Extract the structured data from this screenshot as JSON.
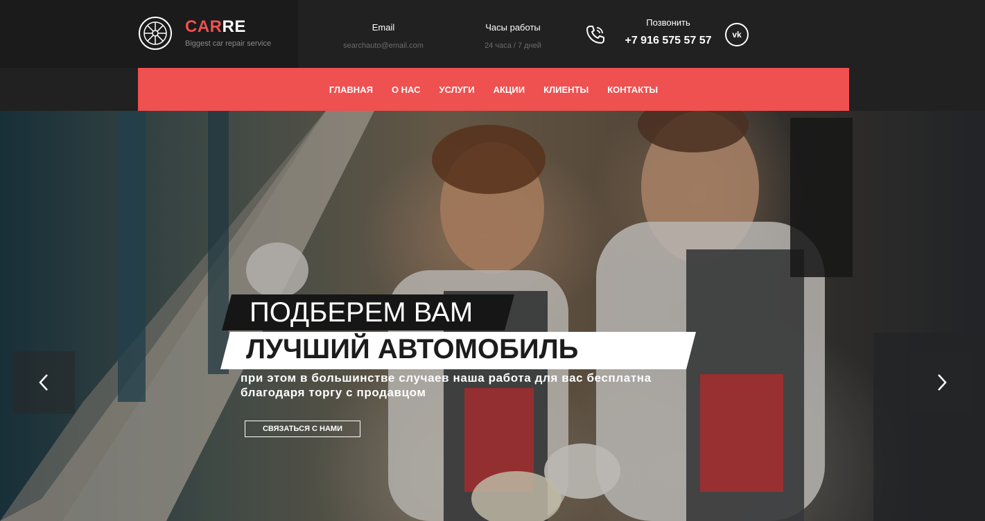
{
  "brand": {
    "name_part1": "CAR",
    "name_part2": "RE",
    "tagline": "Biggest car repair service",
    "accent_color": "#ef5050"
  },
  "contacts": {
    "email_label": "Email",
    "email_value": "searchauto@email.com",
    "hours_label": "Часы работы",
    "hours_value": "24 часа / 7 дней",
    "call_label": "Позвонить",
    "phone": "+7 916 575 57 57",
    "vk_label": "vk"
  },
  "icons": {
    "logo": "wheel-icon",
    "phone": "phone-icon",
    "vk": "vk-icon",
    "prev": "chevron-left-icon",
    "next": "chevron-right-icon"
  },
  "nav": {
    "items": [
      "ГЛАВНАЯ",
      "О НАС",
      "УСЛУГИ",
      "АКЦИИ",
      "КЛИЕНТЫ",
      "КОНТАКТЫ"
    ]
  },
  "hero": {
    "headline_line1": "ПОДБЕРЕМ ВАМ",
    "headline_line2": "ЛУЧШИЙ АВТОМОБИЛЬ",
    "subtitle_line1": "при этом в большинстве случаев наша работа для вас бесплатна",
    "subtitle_line2": "благодаря торгу с продавцом",
    "cta": "СВЯЗАТЬСЯ С НАМИ"
  }
}
